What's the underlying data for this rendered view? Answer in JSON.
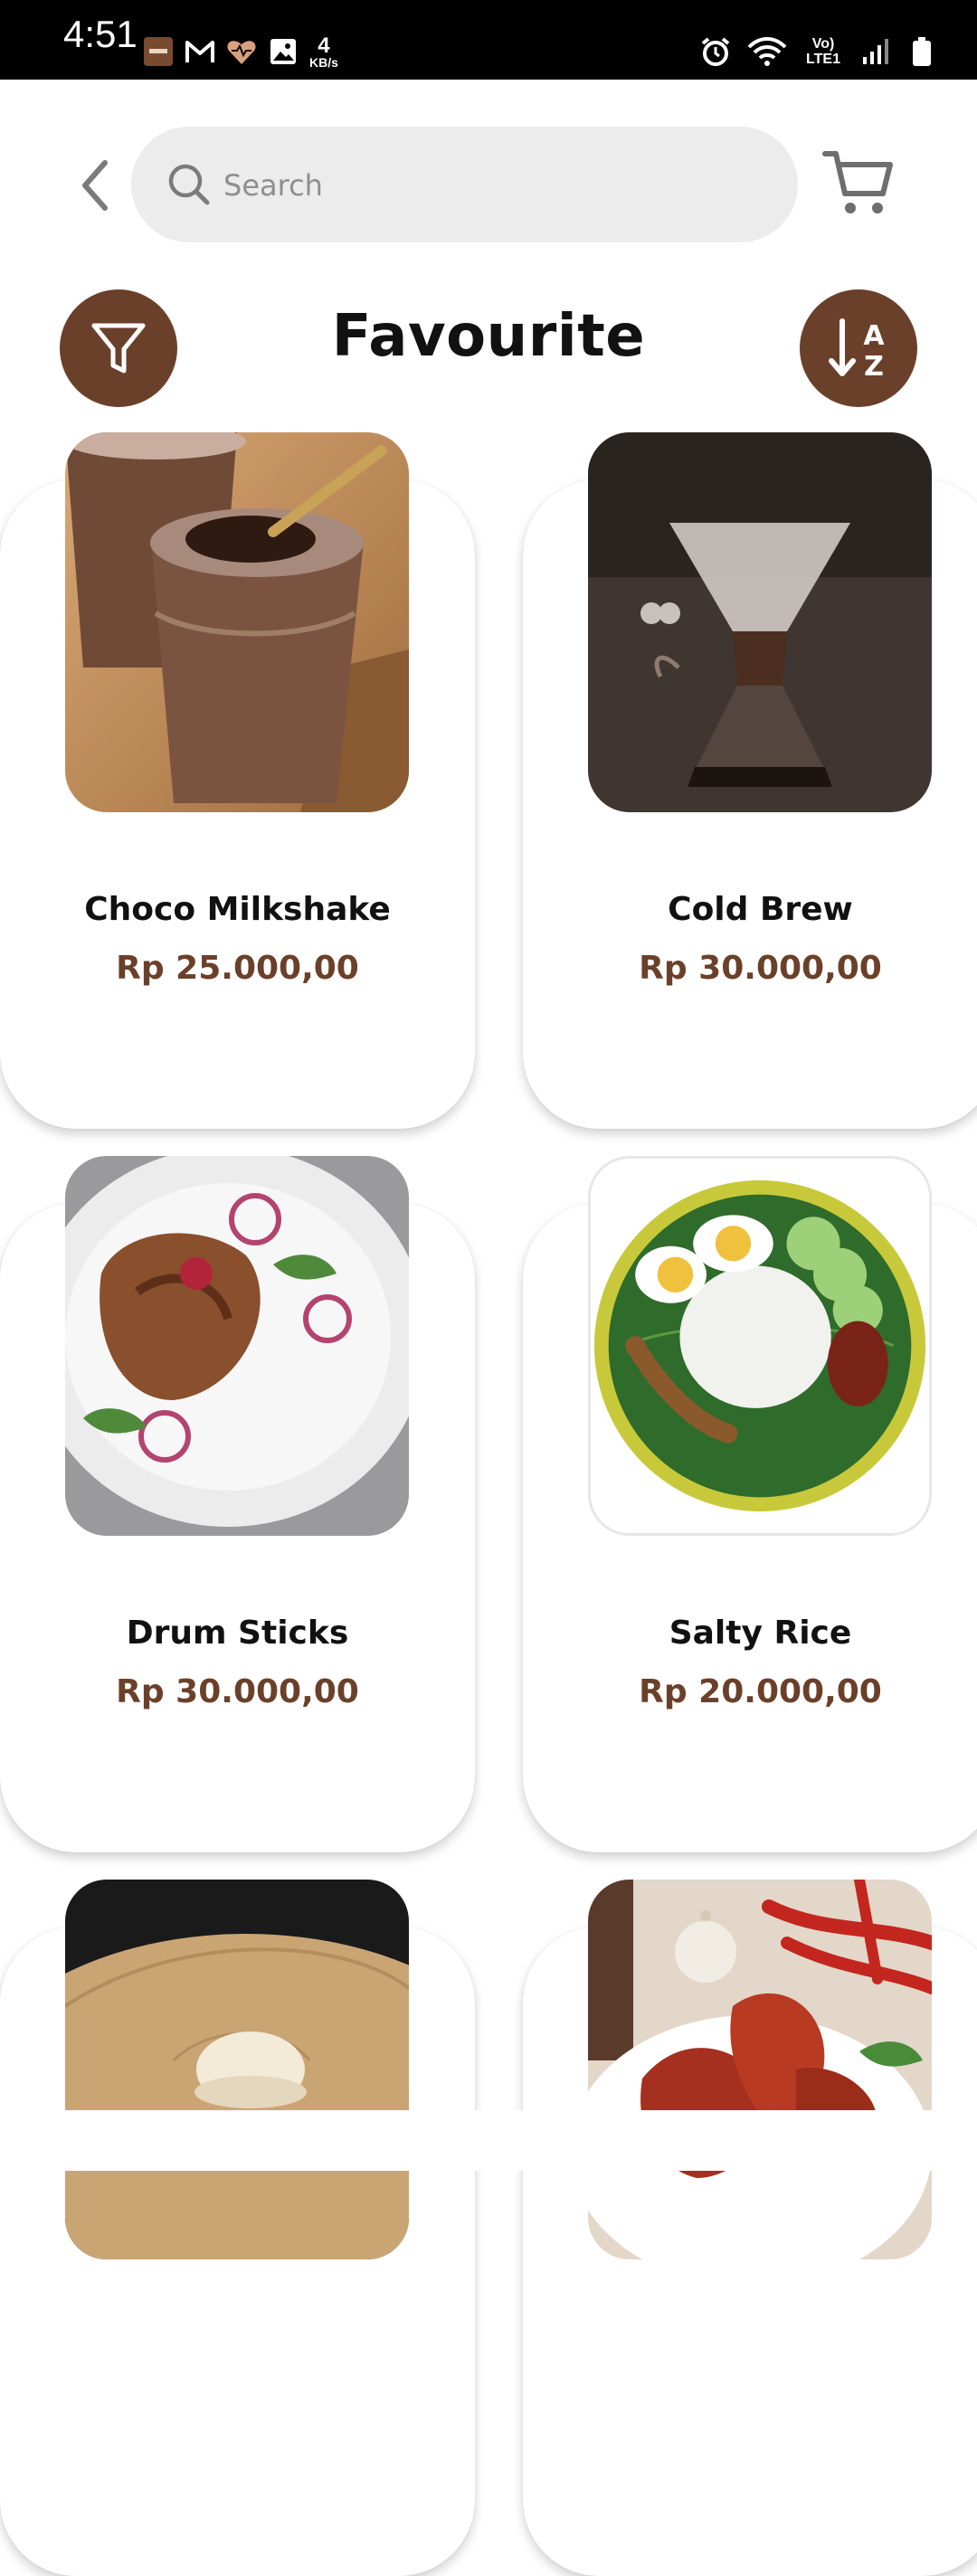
{
  "status_bar": {
    "time": "4:51",
    "speed_value": "4",
    "speed_unit": "KB/s",
    "network_label": "Vo) LTE1",
    "icons": [
      "app-icon",
      "gmail-icon",
      "health-icon",
      "gallery-icon",
      "alarm-icon",
      "wifi-icon",
      "signal-icon",
      "battery-icon"
    ]
  },
  "header": {
    "search_placeholder": "Search",
    "icons": [
      "back-icon",
      "search-icon",
      "cart-icon"
    ]
  },
  "title_row": {
    "title": "Favourite",
    "icons": [
      "filter-icon",
      "sort-az-icon"
    ],
    "sort_letters": [
      "A",
      "Z"
    ]
  },
  "theme": {
    "accent": "#6b402a",
    "text": "#111111",
    "search_bg": "#ececec"
  },
  "products": [
    {
      "name": "Choco Milkshake",
      "price": "Rp 25.000,00",
      "image": "choco-milkshake-image"
    },
    {
      "name": "Cold Brew",
      "price": "Rp 30.000,00",
      "image": "cold-brew-image"
    },
    {
      "name": "Drum Sticks",
      "price": "Rp 30.000,00",
      "image": "drum-sticks-image"
    },
    {
      "name": "Salty Rice",
      "price": "Rp 20.000,00",
      "image": "salty-rice-image"
    },
    {
      "name": "",
      "price": "",
      "image": "dessert-image"
    },
    {
      "name": "",
      "price": "",
      "image": "chicken-wings-image"
    }
  ]
}
